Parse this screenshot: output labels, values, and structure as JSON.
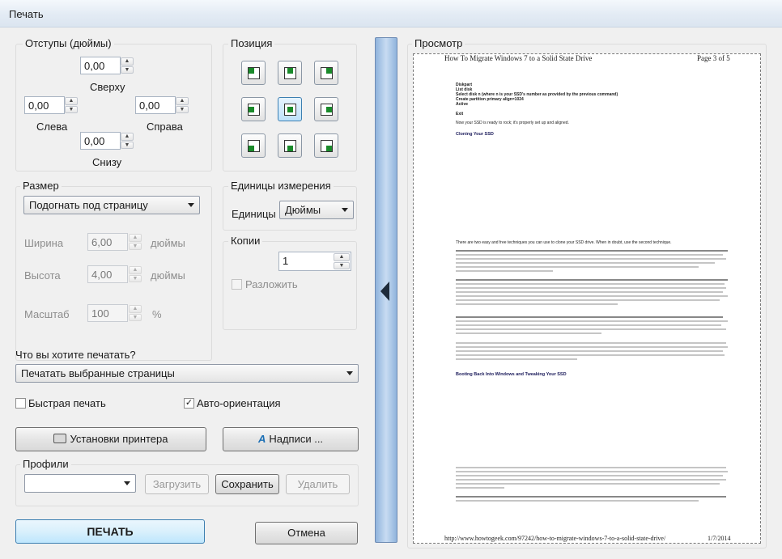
{
  "window": {
    "title": "Печать"
  },
  "margins": {
    "group_title": "Отступы (дюймы)",
    "top": {
      "value": "0,00",
      "label": "Сверху"
    },
    "left": {
      "value": "0,00",
      "label": "Слева"
    },
    "right": {
      "value": "0,00",
      "label": "Справа"
    },
    "bottom": {
      "value": "0,00",
      "label": "Снизу"
    }
  },
  "position": {
    "group_title": "Позиция",
    "selected": "center"
  },
  "size": {
    "group_title": "Размер",
    "mode": "Подогнать под страницу",
    "width": {
      "label": "Ширина",
      "value": "6,00",
      "unit": "дюймы"
    },
    "height": {
      "label": "Высота",
      "value": "4,00",
      "unit": "дюймы"
    },
    "scale": {
      "label": "Масштаб",
      "value": "100",
      "unit": "%"
    }
  },
  "units": {
    "group_title": "Единицы измерения",
    "label": "Единицы",
    "value": "Дюймы"
  },
  "copies": {
    "group_title": "Копии",
    "value": "1",
    "collate_label": "Разложить",
    "collate_checked": false
  },
  "what_to_print": {
    "label": "Что вы хотите печатать?",
    "value": "Печатать выбранные страницы"
  },
  "options": {
    "fast_print": {
      "label": "Быстрая печать",
      "checked": false
    },
    "auto_orient": {
      "label": "Авто-ориентация",
      "checked": true,
      "mark": "✓"
    }
  },
  "buttons": {
    "printer_setup": "Установки принтера",
    "captions": "Надписи ...",
    "load": "Загрузить",
    "save": "Сохранить",
    "delete": "Удалить",
    "print": "ПЕЧАТЬ",
    "cancel": "Отмена"
  },
  "profiles": {
    "group_title": "Профили",
    "value": ""
  },
  "preview": {
    "title": "Просмотр",
    "header_title": "How To Migrate Windows 7 to a Solid State Drive",
    "header_page": "Page 3 of 5",
    "code_lines": [
      "Diskpart",
      "List disk",
      "Select disk n (where n is your SSD's number as provided by the previous command)",
      "Create partition primary align=1024",
      "Active",
      "",
      "Exit"
    ],
    "line_ready": "Now your SSD is ready to rock; it's properly set up and aligned.",
    "heading_cloning": "Cloning Your SSD",
    "para_two_ways": "There are two easy and free techniques you can use to clone your SSD drive. When in doubt, use the second technique.",
    "heading_booting": "Booting Back Into Windows and Tweaking Your SSD",
    "footer_url": "http://www.howtogeek.com/97242/how-to-migrate-windows-7-to-a-solid-state-drive/",
    "footer_date": "1/7/2014"
  },
  "colors": {
    "accent": "#3c7fb1",
    "divider": "#8fb3dc",
    "position_dot": "#1a8a2a"
  }
}
